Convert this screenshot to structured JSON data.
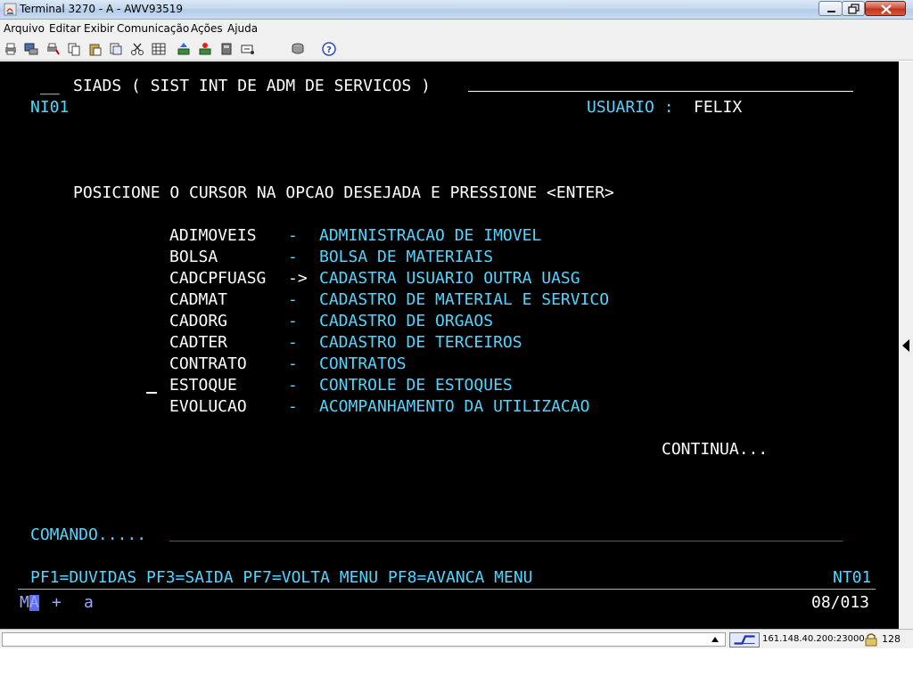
{
  "window": {
    "title": "Terminal 3270 - A - AWV93519"
  },
  "menu": {
    "items": [
      "Arquivo",
      "Editar",
      "Exibir",
      "Comunicação",
      "Ações",
      "Ajuda"
    ]
  },
  "toolbar": {
    "icons": [
      "print-icon",
      "print-screen-icon",
      "print-setup-icon",
      "copy-icon",
      "paste-icon",
      "copy-append-icon",
      "cut-icon",
      "keypad-icon",
      "send-file-icon",
      "receive-file-icon",
      "transfer-icon",
      "macro-icon",
      "archive-icon",
      "help-icon"
    ]
  },
  "terminal": {
    "header_prefix": "__",
    "system_title": "SIADS ( SIST INT DE ADM DE SERVICOS )",
    "screen_id": "NI01",
    "user_label": "USUARIO :",
    "user_name": "FELIX",
    "instruction": "POSICIONE O CURSOR NA OPCAO DESEJADA E PRESSIONE <ENTER>",
    "options": [
      {
        "code": "ADIMOVEIS",
        "sep": "-",
        "desc": "ADMINISTRACAO DE IMOVEL"
      },
      {
        "code": "BOLSA",
        "sep": "-",
        "desc": "BOLSA DE MATERIAIS"
      },
      {
        "code": "CADCPFUASG",
        "sep": "->",
        "desc": "CADASTRA USUARIO OUTRA UASG"
      },
      {
        "code": "CADMAT",
        "sep": "-",
        "desc": "CADASTRO DE MATERIAL E SERVICO"
      },
      {
        "code": "CADORG",
        "sep": "-",
        "desc": "CADASTRO DE ORGAOS"
      },
      {
        "code": "CADTER",
        "sep": "-",
        "desc": "CADASTRO DE TERCEIROS"
      },
      {
        "code": "CONTRATO",
        "sep": "-",
        "desc": "CONTRATOS"
      },
      {
        "code": "ESTOQUE",
        "sep": "-",
        "desc": "CONTROLE DE ESTOQUES"
      },
      {
        "code": "EVOLUCAO",
        "sep": "-",
        "desc": "ACOMPANHAMENTO DA UTILIZACAO"
      }
    ],
    "continua": "CONTINUA...",
    "command_label": "COMANDO.....",
    "command_value": "",
    "function_keys": "PF1=DUVIDAS PF3=SAIDA PF7=VOLTA MENU PF8=AVANCA MENU",
    "screen_code": "NT01"
  },
  "oia": {
    "mode_left": "M",
    "mode_cursor": "A",
    "plus": "+",
    "indicator": "a",
    "cursor_position": "08/013"
  },
  "statusbar": {
    "host": "161.148.40.200:23000",
    "ssl_bits": "128"
  },
  "colors": {
    "terminal_bg": "#000000",
    "field_protected": "#ffffff",
    "field_cyan": "#4fd6ff",
    "oia_blue": "#9aa9ff",
    "command_underline": "#e0202e"
  }
}
